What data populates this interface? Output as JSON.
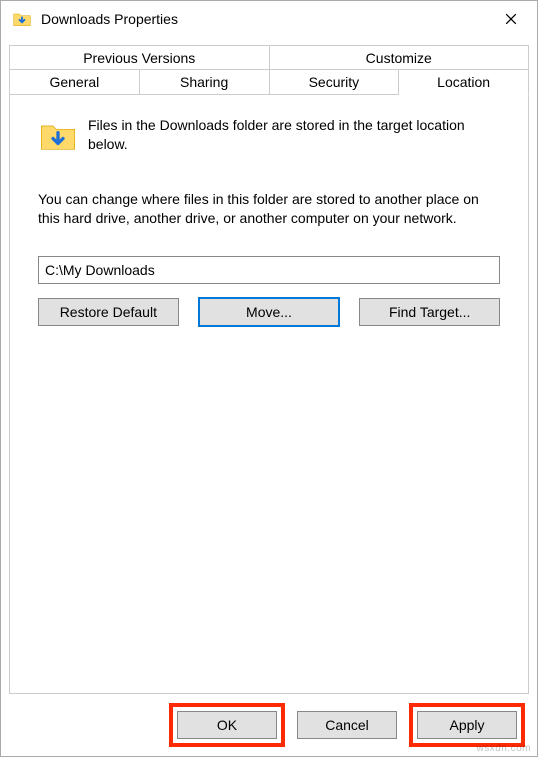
{
  "window": {
    "title": "Downloads Properties"
  },
  "tabs": {
    "row1": [
      {
        "label": "Previous Versions"
      },
      {
        "label": "Customize"
      }
    ],
    "row2": [
      {
        "label": "General"
      },
      {
        "label": "Sharing"
      },
      {
        "label": "Security"
      },
      {
        "label": "Location",
        "active": true
      }
    ]
  },
  "location_tab": {
    "intro": "Files in the Downloads folder are stored in the target location below.",
    "description": "You can change where files in this folder are stored to another place on this hard drive, another drive, or another computer on your network.",
    "path_value": "C:\\My Downloads",
    "buttons": {
      "restore": "Restore Default",
      "move": "Move...",
      "find_target": "Find Target..."
    }
  },
  "footer": {
    "ok": "OK",
    "cancel": "Cancel",
    "apply": "Apply"
  },
  "watermark": "wsxdn.com"
}
